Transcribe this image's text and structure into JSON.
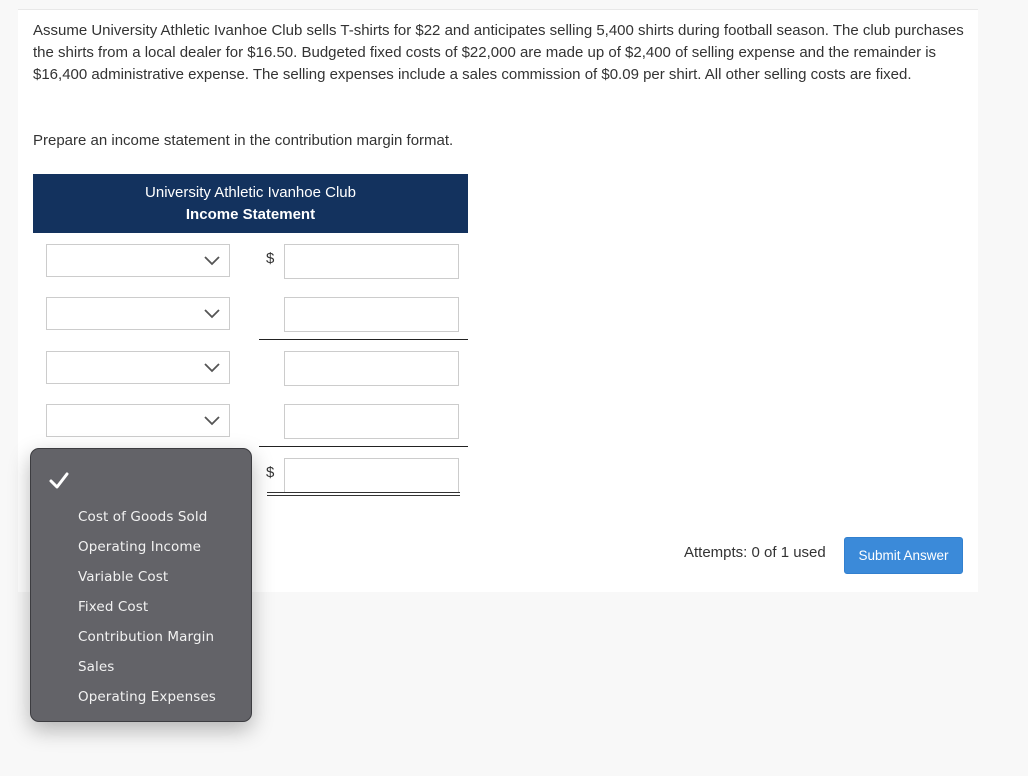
{
  "problem": {
    "text": "Assume University Athletic Ivanhoe Club sells T-shirts for $22 and anticipates selling 5,400 shirts during football season. The club purchases the shirts from a local dealer for $16.50. Budgeted fixed costs of $22,000 are made up of $2,400 of selling expense and the remainder is $16,400 administrative expense. The selling expenses include a sales commission of $0.09 per shirt. All other selling costs are fixed.",
    "instruction": "Prepare an income statement in the contribution margin format."
  },
  "statement": {
    "company": "University Athletic Ivanhoe Club",
    "title": "Income Statement",
    "header_color": "#13325e",
    "currency_symbol": "$",
    "rows": [
      {
        "account": "",
        "amount": "",
        "currency": "$"
      },
      {
        "account": "",
        "amount": "",
        "currency": ""
      },
      {
        "account": "",
        "amount": "",
        "currency": ""
      },
      {
        "account": "",
        "amount": "",
        "currency": ""
      },
      {
        "account": "",
        "amount": "",
        "currency": "$"
      }
    ]
  },
  "dropdown_popup": {
    "selected_icon": "checkmark-icon",
    "selected_label": "",
    "options": [
      "Cost of Goods Sold",
      "Operating Income",
      "Variable Cost",
      "Fixed Cost",
      "Contribution Margin",
      "Sales",
      "Operating Expenses"
    ]
  },
  "footer": {
    "attempts": "Attempts: 0 of 1 used",
    "submit_label": "Submit Answer",
    "submit_color": "#3b8ad9"
  }
}
